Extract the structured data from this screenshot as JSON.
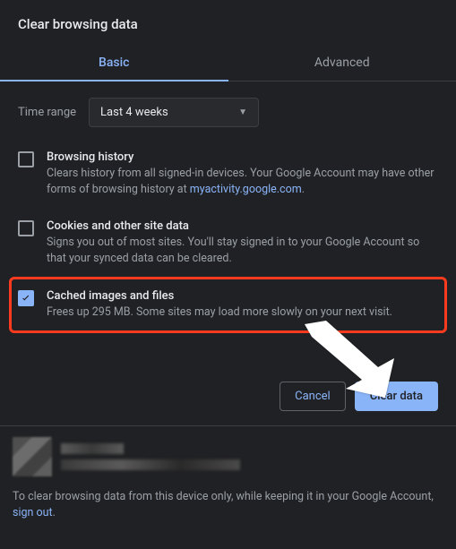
{
  "dialog": {
    "title": "Clear browsing data",
    "tabs": {
      "basic": "Basic",
      "advanced": "Advanced",
      "active": "basic"
    }
  },
  "timerange": {
    "label": "Time range",
    "value": "Last 4 weeks"
  },
  "options": {
    "history": {
      "title": "Browsing history",
      "desc_pre": "Clears history from all signed-in devices. Your Google Account may have other forms of browsing history at ",
      "desc_link": "myactivity.google.com",
      "desc_post": ".",
      "checked": false
    },
    "cookies": {
      "title": "Cookies and other site data",
      "desc": "Signs you out of most sites. You'll stay signed in to your Google Account so that your synced data can be cleared.",
      "checked": false
    },
    "cache": {
      "title": "Cached images and files",
      "desc": "Frees up 295 MB. Some sites may load more slowly on your next visit.",
      "checked": true
    }
  },
  "actions": {
    "cancel": "Cancel",
    "clear": "Clear data"
  },
  "footer": {
    "text_pre": "To clear browsing data from this device only, while keeping it in your Google Account, ",
    "link": "sign out",
    "text_post": "."
  }
}
